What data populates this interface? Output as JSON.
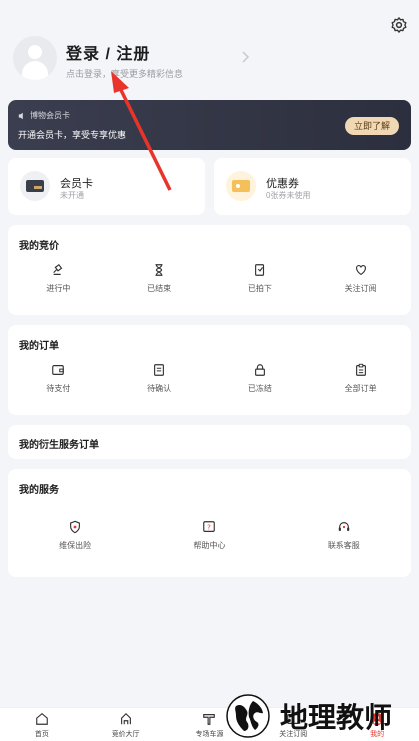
{
  "header": {
    "login_title": "登录 / 注册",
    "login_subtitle": "点击登录，享受更多精彩信息"
  },
  "vip": {
    "tag": "博物会员卡",
    "description": "开通会员卡，享受专享优惠",
    "button": "立即了解"
  },
  "cards": {
    "member": {
      "title": "会员卡",
      "subtitle": "未开通"
    },
    "coupon": {
      "title": "优惠券",
      "subtitle": "0张券未使用"
    }
  },
  "bids": {
    "title": "我的竞价",
    "items": [
      {
        "label": "进行中",
        "icon": "gavel-icon"
      },
      {
        "label": "已结束",
        "icon": "hourglass-icon"
      },
      {
        "label": "已拍下",
        "icon": "bid-won-icon"
      },
      {
        "label": "关注订阅",
        "icon": "heart-icon"
      }
    ]
  },
  "orders": {
    "title": "我的订单",
    "items": [
      {
        "label": "待支付",
        "icon": "wallet-icon"
      },
      {
        "label": "待确认",
        "icon": "document-icon"
      },
      {
        "label": "已冻结",
        "icon": "lock-icon"
      },
      {
        "label": "全部订单",
        "icon": "clipboard-icon"
      }
    ]
  },
  "derivative": {
    "title": "我的衍生服务订单"
  },
  "services": {
    "title": "我的服务",
    "items": [
      {
        "label": "维保出险",
        "icon": "shield-icon"
      },
      {
        "label": "帮助中心",
        "icon": "help-icon"
      },
      {
        "label": "联系客服",
        "icon": "headset-icon"
      }
    ]
  },
  "tabbar": [
    {
      "label": "首页",
      "icon": "home-icon"
    },
    {
      "label": "竞价大厅",
      "icon": "auction-hall-icon"
    },
    {
      "label": "专场车源",
      "icon": "special-icon"
    },
    {
      "label": "关注订阅",
      "icon": "subscribe-icon"
    },
    {
      "label": "我的",
      "icon": "profile-icon"
    }
  ],
  "watermark": {
    "text": "地理教师"
  },
  "colors": {
    "accent": "#e23a2e",
    "vip_dark": "#2c2f3d",
    "vip_gold": "#f1d8b4"
  }
}
